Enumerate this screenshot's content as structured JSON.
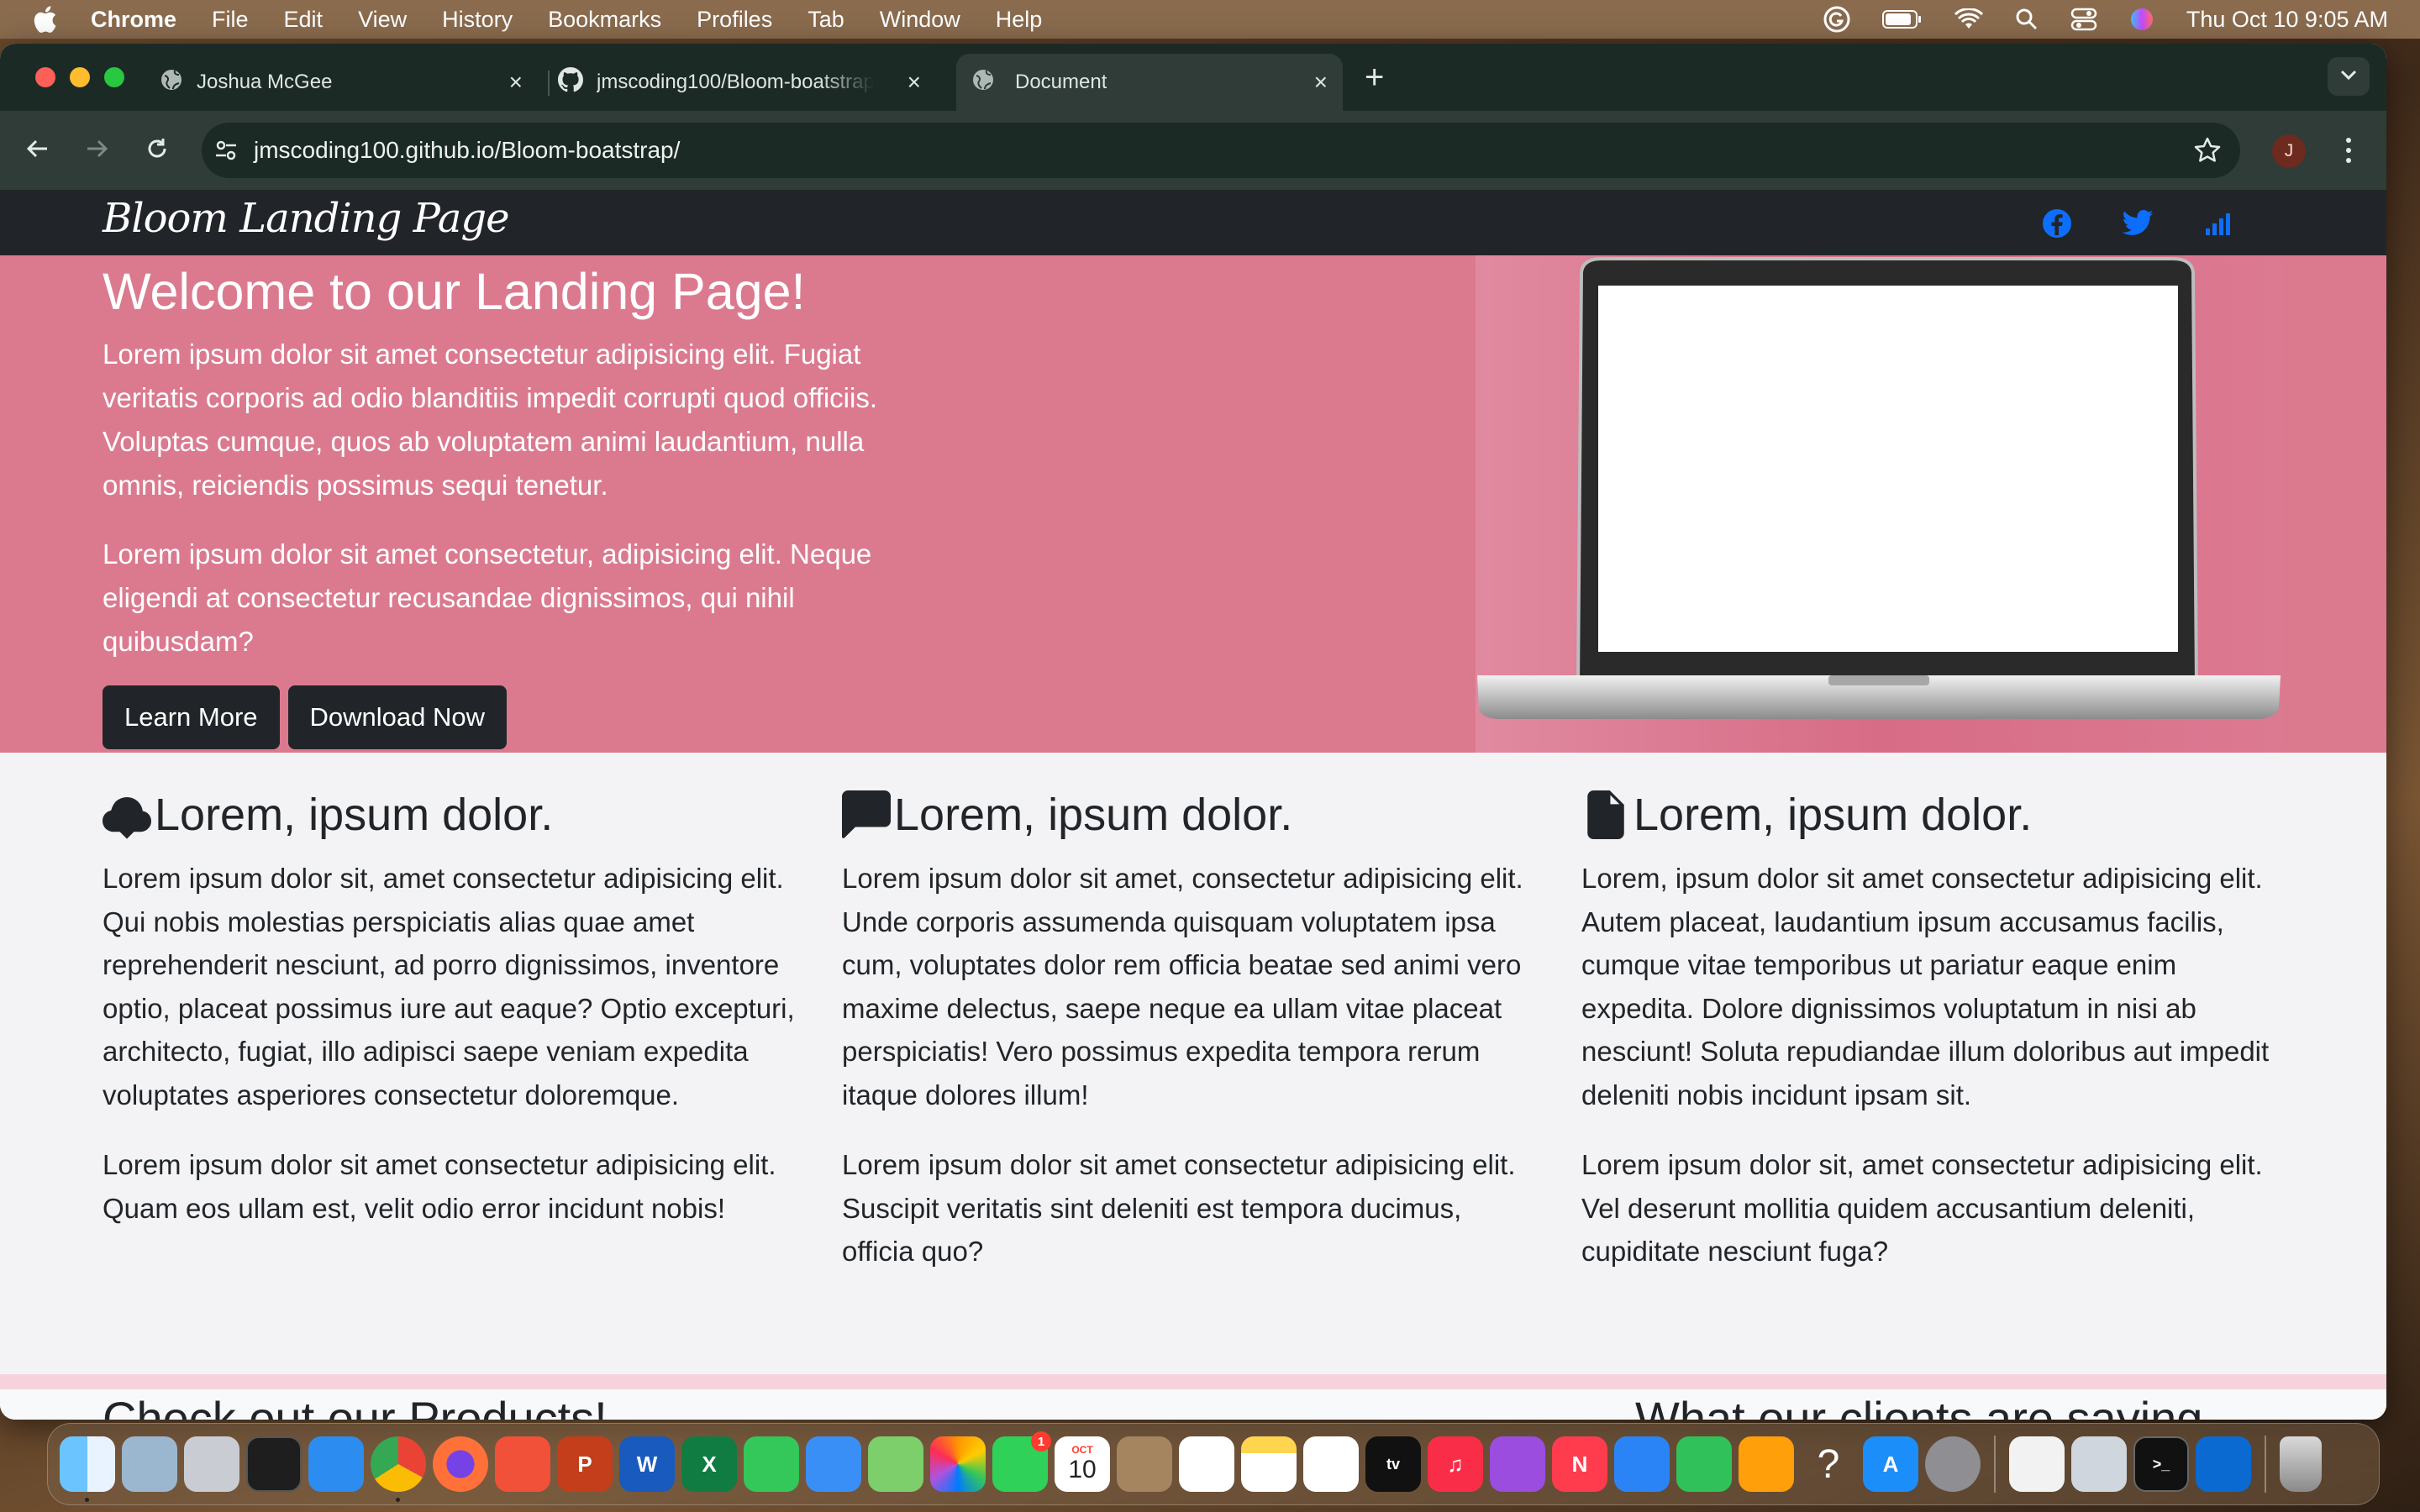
{
  "menubar": {
    "items": [
      "Chrome",
      "File",
      "Edit",
      "View",
      "History",
      "Bookmarks",
      "Profiles",
      "Tab",
      "Window",
      "Help"
    ],
    "datetime": "Thu Oct 10  9:05 AM"
  },
  "browser": {
    "tabs": [
      {
        "title": "Joshua McGee",
        "icon": "globe-icon"
      },
      {
        "title": "jmscoding100/Bloom-boatstrap",
        "icon": "github-icon"
      },
      {
        "title": "Document",
        "icon": "globe-icon"
      }
    ],
    "url": "jmscoding100.github.io/Bloom-boatstrap/",
    "profile_initial": "J"
  },
  "site": {
    "brand": "Bloom Landing Page",
    "social_icons": [
      "facebook-icon",
      "twitter-icon",
      "signal-bars-icon"
    ],
    "hero": {
      "title": "Welcome to our Landing Page!",
      "p1": "Lorem ipsum dolor sit amet consectetur adipisicing elit. Fugiat veritatis corporis ad odio blanditiis impedit corrupti quod officiis. Voluptas cumque, quos ab voluptatem animi laudantium, nulla omnis, reiciendis possimus sequi tenetur.",
      "p2": "Lorem ipsum dolor sit amet consectetur, adipisicing elit. Neque eligendi at consectetur recusandae dignissimos, qui nihil quibusdam?",
      "learn_more": "Learn More",
      "download_now": "Download Now",
      "image": "laptop-image"
    },
    "features": [
      {
        "icon": "cloud-download-icon",
        "heading": "Lorem, ipsum dolor.",
        "p1": "Lorem ipsum dolor sit, amet consectetur adipisicing elit. Qui nobis molestias perspiciatis alias quae amet reprehenderit nesciunt, ad porro dignissimos, inventore optio, placeat possimus iure aut eaque? Optio excepturi, architecto, fugiat, illo adipisci saepe veniam expedita voluptates asperiores consectetur doloremque.",
        "p2": "Lorem ipsum dolor sit amet consectetur adipisicing elit. Quam eos ullam est, velit odio error incidunt nobis!"
      },
      {
        "icon": "chat-icon",
        "heading": "Lorem, ipsum dolor.",
        "p1": "Lorem ipsum dolor sit amet, consectetur adipisicing elit. Unde corporis assumenda quisquam voluptatem ipsa cum, voluptates dolor rem officia beatae sed animi vero maxime delectus, saepe neque ea ullam vitae placeat perspiciatis! Vero possimus expedita tempora rerum itaque dolores illum!",
        "p2": "Lorem ipsum dolor sit amet consectetur adipisicing elit. Suscipit veritatis sint deleniti est tempora ducimus, officia quo?"
      },
      {
        "icon": "file-icon",
        "heading": "Lorem, ipsum dolor.",
        "p1": "Lorem, ipsum dolor sit amet consectetur adipisicing elit. Autem placeat, laudantium ipsum accusamus facilis, cumque vitae temporibus ut pariatur eaque enim expedita. Dolore dignissimos voluptatum in nisi ab nesciunt! Soluta repudiandae illum doloribus aut impedit deleniti nobis incidunt ipsam sit.",
        "p2": "Lorem ipsum dolor sit, amet consectetur adipisicing elit. Vel deserunt mollitia quidem accusantium deleniti, cupiditate nesciunt fuga?"
      }
    ],
    "bottom_left_heading": "Check out our Products!",
    "bottom_right_heading": "What our clients are saying"
  },
  "dock": {
    "icons": [
      "finder-icon",
      "preview-icon",
      "launchpad-icon",
      "terminal-exec-icon",
      "safari-icon",
      "chrome-icon",
      "firefox-icon",
      "swift-icon",
      "powerpoint-icon",
      "word-icon",
      "excel-icon",
      "messages-icon",
      "mail-icon",
      "maps-icon",
      "photos-icon",
      "facetime-icon",
      "calendar-icon",
      "contacts-icon",
      "reminders-icon",
      "notes-icon",
      "freeform-icon",
      "apple-tv-icon",
      "music-icon",
      "podcasts-icon",
      "news-icon",
      "keynote-icon",
      "numbers-icon",
      "pages-icon",
      "tips-icon",
      "app-store-icon",
      "system-settings-icon",
      "textedit-icon",
      "screenshot-icon",
      "terminal-icon",
      "vscode-icon",
      "trash-icon"
    ],
    "facetime_badge": "1",
    "calendar_month": "OCT",
    "calendar_day": "10"
  },
  "colors": {
    "hero_bg": "#db7a8f",
    "nav_bg": "#212529",
    "button_bg": "#212529",
    "social_icon": "#0d6efd",
    "browser_frame": "#1c2a26"
  }
}
